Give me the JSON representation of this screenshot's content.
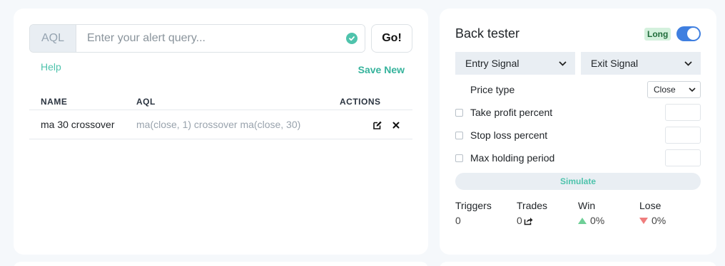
{
  "query": {
    "prefix": "AQL",
    "placeholder": "Enter your alert query...",
    "value": "",
    "go_label": "Go!",
    "help_label": "Help",
    "save_new_label": "Save New"
  },
  "alerts_table": {
    "columns": [
      "NAME",
      "AQL",
      "ACTIONS"
    ],
    "rows": [
      {
        "name": "ma 30 crossover",
        "aql": "ma(close, 1) crossover ma(close, 30)"
      }
    ]
  },
  "backtester": {
    "title": "Back tester",
    "mode_badge": "Long",
    "mode_toggle_on": true,
    "entry_signal_label": "Entry Signal",
    "exit_signal_label": "Exit Signal",
    "price_type_label": "Price type",
    "price_type_value": "Close",
    "options": [
      {
        "label": "Take profit percent",
        "checked": false,
        "value": ""
      },
      {
        "label": "Stop loss percent",
        "checked": false,
        "value": ""
      },
      {
        "label": "Max holding period",
        "checked": false,
        "value": ""
      }
    ],
    "simulate_label": "Simulate",
    "stats": {
      "triggers_label": "Triggers",
      "triggers_value": "0",
      "trades_label": "Trades",
      "trades_value": "0",
      "win_label": "Win",
      "win_value": "0%",
      "lose_label": "Lose",
      "lose_value": "0%"
    }
  },
  "colors": {
    "accent": "#4fc3ac",
    "toggle": "#3f7fe0",
    "win": "#6fcf97",
    "lose": "#ef7d7d",
    "badge_bg": "#d4f1dd"
  },
  "icons": {
    "valid": "check-circle-icon",
    "edit": "edit-icon",
    "delete": "close-icon",
    "dropdown": "chevron-down-icon",
    "trades_link": "share-icon"
  }
}
